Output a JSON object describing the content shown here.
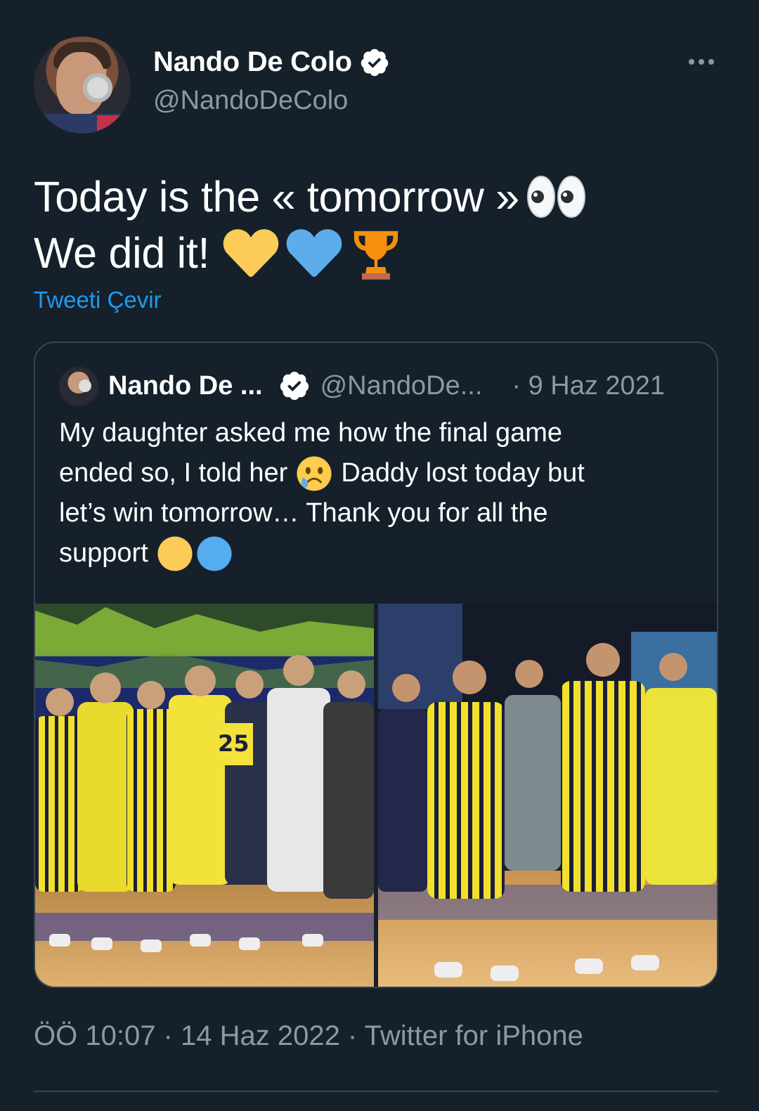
{
  "tweet": {
    "author_name": "Nando De Colo",
    "author_handle": "@NandoDeColo",
    "text_line1": "Today is the « tomorrow »",
    "text_line2": "We did it!",
    "translate_label": "Tweeti Çevir",
    "timestamp": "ÖÖ 10:07 · 14 Haz 2022 · Twitter for iPhone",
    "icons": [
      "verified-badge-icon",
      "more-options-icon",
      "eyes-emoji",
      "yellow-heart-emoji",
      "blue-heart-emoji",
      "trophy-emoji"
    ]
  },
  "quote": {
    "author_name": "Nando De ...",
    "author_handle": "@NandoDe...",
    "date": "· 9 Haz 2021",
    "line1": "My daughter asked me how the final game",
    "line2a": "ended so, I told her",
    "line2b": "Daddy lost today but",
    "line3": "let’s win tomorrow… Thank you for all the",
    "line4": "support",
    "icons": [
      "crying-face-emoji",
      "yellow-circle-emoji",
      "blue-circle-emoji"
    ],
    "photos": [
      "team-huddle-photo",
      "team-applauding-photo"
    ]
  },
  "colors": {
    "background": "#15202b",
    "secondary_text": "#8b98a5",
    "link": "#1d9bf0",
    "border": "#38444d"
  }
}
